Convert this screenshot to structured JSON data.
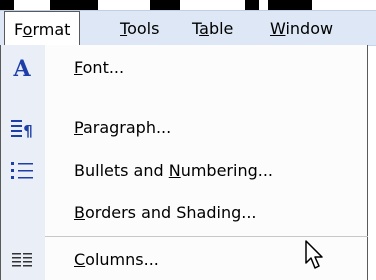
{
  "menubar": {
    "items": [
      {
        "pre": "F",
        "acc": "o",
        "post": "rmat",
        "active": true
      },
      {
        "pre": "",
        "acc": "T",
        "post": "ools",
        "active": false
      },
      {
        "pre": "T",
        "acc": "a",
        "post": "ble",
        "active": false
      },
      {
        "pre": "",
        "acc": "W",
        "post": "indow",
        "active": false
      }
    ]
  },
  "dropdown": {
    "items": [
      {
        "icon": "font-icon",
        "pre": "",
        "acc": "F",
        "post": "ont..."
      },
      {
        "icon": "paragraph-icon",
        "pre": "",
        "acc": "P",
        "post": "aragraph..."
      },
      {
        "icon": "bullets-icon",
        "pre": "Bullets and ",
        "acc": "N",
        "post": "umbering..."
      },
      {
        "icon": "",
        "pre": "",
        "acc": "B",
        "post": "orders and Shading..."
      },
      {
        "icon": "columns-icon",
        "pre": "",
        "acc": "C",
        "post": "olumns..."
      }
    ]
  },
  "colors": {
    "menubar_bg": "#dde7f6",
    "gutter_bg": "#e9eef7",
    "icon_blue": "#1f3fa8"
  }
}
